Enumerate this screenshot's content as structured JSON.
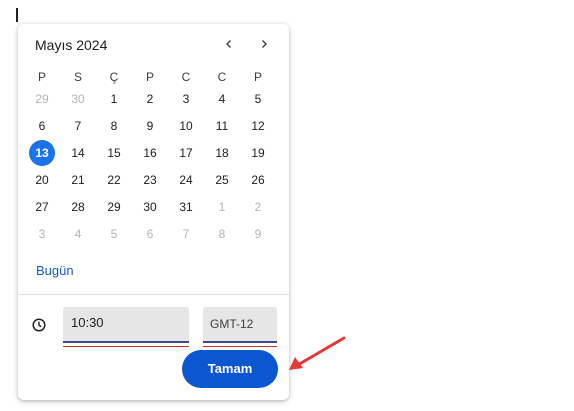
{
  "calendar": {
    "month_title": "Mayıs 2024",
    "prev_icon": "chevron-left-icon",
    "next_icon": "chevron-right-icon",
    "weekdays": [
      "P",
      "S",
      "Ç",
      "P",
      "C",
      "C",
      "P"
    ],
    "weeks": [
      [
        {
          "d": "29",
          "muted": true
        },
        {
          "d": "30",
          "muted": true
        },
        {
          "d": "1"
        },
        {
          "d": "2"
        },
        {
          "d": "3"
        },
        {
          "d": "4"
        },
        {
          "d": "5"
        }
      ],
      [
        {
          "d": "6"
        },
        {
          "d": "7"
        },
        {
          "d": "8"
        },
        {
          "d": "9"
        },
        {
          "d": "10"
        },
        {
          "d": "11"
        },
        {
          "d": "12"
        }
      ],
      [
        {
          "d": "13",
          "selected": true
        },
        {
          "d": "14"
        },
        {
          "d": "15"
        },
        {
          "d": "16"
        },
        {
          "d": "17"
        },
        {
          "d": "18"
        },
        {
          "d": "19"
        }
      ],
      [
        {
          "d": "20"
        },
        {
          "d": "21"
        },
        {
          "d": "22"
        },
        {
          "d": "23"
        },
        {
          "d": "24"
        },
        {
          "d": "25"
        },
        {
          "d": "26"
        }
      ],
      [
        {
          "d": "27"
        },
        {
          "d": "28"
        },
        {
          "d": "29"
        },
        {
          "d": "30"
        },
        {
          "d": "31"
        },
        {
          "d": "1",
          "muted": true
        },
        {
          "d": "2",
          "muted": true
        }
      ],
      [
        {
          "d": "3",
          "muted": true
        },
        {
          "d": "4",
          "muted": true
        },
        {
          "d": "5",
          "muted": true
        },
        {
          "d": "6",
          "muted": true
        },
        {
          "d": "7",
          "muted": true
        },
        {
          "d": "8",
          "muted": true
        },
        {
          "d": "9",
          "muted": true
        }
      ]
    ],
    "today_label": "Bugün"
  },
  "time": {
    "clock_icon": "clock-icon",
    "value": "10:30",
    "timezone": "GMT-12"
  },
  "actions": {
    "ok_label": "Tamam"
  },
  "annotation": {
    "arrow_icon": "red-arrow-icon",
    "color": "#e53935"
  },
  "colors": {
    "selected_day": "#1a73e8",
    "primary_button": "#0b57d0",
    "link": "#1a5fb4"
  }
}
